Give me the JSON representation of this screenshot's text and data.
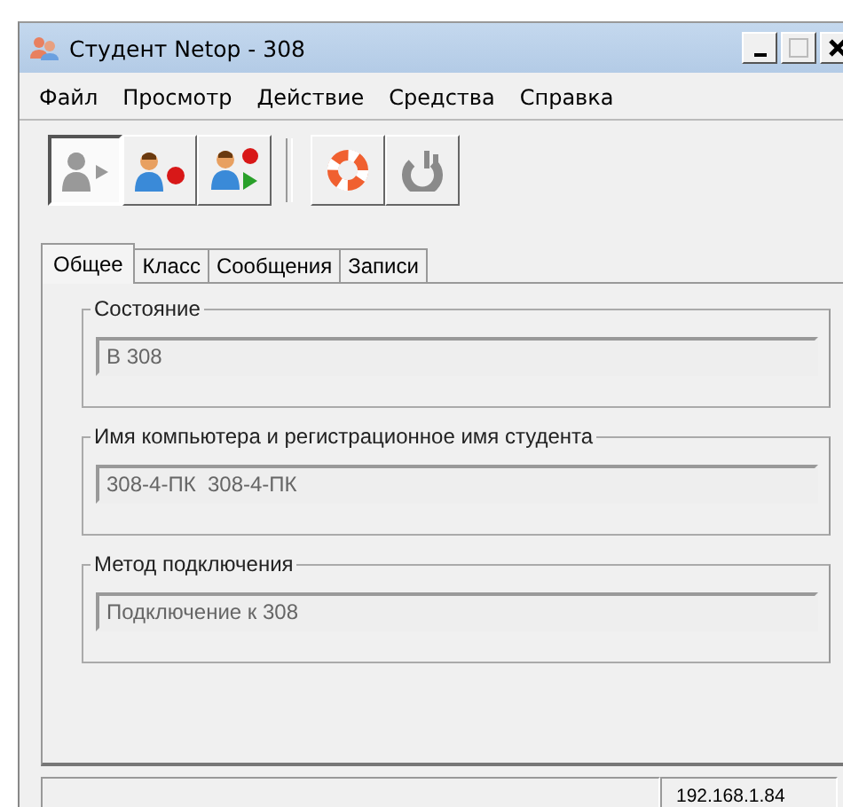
{
  "window": {
    "title": "Студент Netop - 308"
  },
  "menu": [
    "Файл",
    "Просмотр",
    "Действие",
    "Средства",
    "Справка"
  ],
  "toolbar_groups": [
    [
      {
        "kind": "person-play",
        "pressed": true
      },
      {
        "kind": "person-record",
        "pressed": false
      },
      {
        "kind": "person-record-play",
        "pressed": false
      }
    ],
    [
      {
        "kind": "lifebuoy",
        "pressed": false
      },
      {
        "kind": "plug",
        "pressed": false
      }
    ]
  ],
  "tabs": [
    {
      "label": "Общее",
      "selected": true
    },
    {
      "label": "Класс",
      "selected": false
    },
    {
      "label": "Сообщения",
      "selected": false
    },
    {
      "label": "Записи",
      "selected": false
    }
  ],
  "groups": [
    {
      "title": "Состояние",
      "value": "В 308"
    },
    {
      "title": "Имя компьютера и регистрационное имя студента",
      "value": "308-4-ПК  308-4-ПК"
    },
    {
      "title": "Метод подключения",
      "value": "Подключение к 308"
    }
  ],
  "status_bar": {
    "ip": "192.168.1.84"
  }
}
